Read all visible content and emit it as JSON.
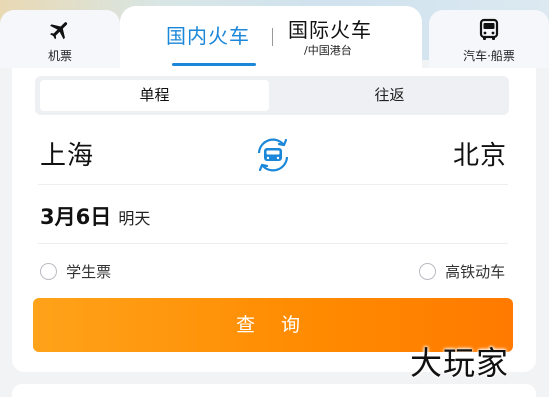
{
  "tabs": {
    "flight": {
      "label": "机票",
      "icon": "airplane-icon"
    },
    "domestic": {
      "label": "国内火车"
    },
    "international": {
      "label": "国际火车",
      "sublabel": "/中国港台"
    },
    "bus_ship": {
      "label": "汽车·船票",
      "icon": "bus-icon"
    }
  },
  "trip_type": {
    "one_way": "单程",
    "round_trip": "往返",
    "selected": "单程"
  },
  "route": {
    "from": "上海",
    "to": "北京",
    "swap_icon": "swap-train-icon"
  },
  "date": {
    "value": "3月6日",
    "weekday": "明天"
  },
  "options": {
    "student": "学生票",
    "high_speed": "高铁动车"
  },
  "search_button": "查 询",
  "watermark": "大玩家",
  "colors": {
    "accent_blue": "#1a87d9",
    "button_orange": "#ff8a00",
    "text_dark": "#111111"
  }
}
